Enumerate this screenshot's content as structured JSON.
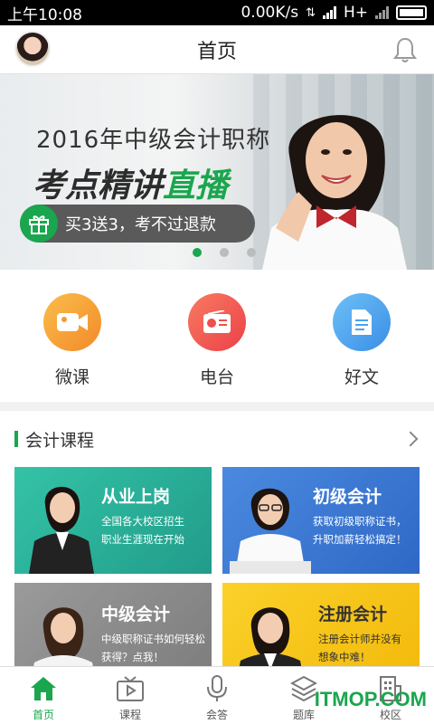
{
  "status_bar": {
    "time": "上午10:08",
    "speed": "0.00K/s",
    "network": "H+"
  },
  "header": {
    "title": "首页",
    "avatar_icon": "avatar-photo",
    "bell_icon": "bell-icon"
  },
  "banner": {
    "line1": "2016年中级会计职称",
    "line2_dark": "考点精讲",
    "line2_green": "直播",
    "promo": "买3送3，考不过退款",
    "slide_count": 3,
    "active_slide": 1
  },
  "quick_menu": [
    {
      "label": "微课",
      "icon": "video-icon",
      "color": "#f7a135"
    },
    {
      "label": "电台",
      "icon": "radio-icon",
      "color": "#f05a4f"
    },
    {
      "label": "好文",
      "icon": "document-icon",
      "color": "#4aa3ee"
    }
  ],
  "course_section": {
    "title": "会计课程",
    "cards": [
      {
        "title": "从业上岗",
        "subtitle_line1": "全国各大校区招生",
        "subtitle_line2": "职业生涯现在开始",
        "color": "#2bb59b"
      },
      {
        "title": "初级会计",
        "subtitle_line1": "获取初级职称证书，",
        "subtitle_line2": "升职加薪轻松搞定！",
        "color": "#3f7bd4"
      },
      {
        "title": "中级会计",
        "subtitle_line1": "中级职称证书如何轻松",
        "subtitle_line2": "获得？点我！",
        "color": "#8d8d8d"
      },
      {
        "title": "注册会计",
        "subtitle_line1": "注册会计师并没有",
        "subtitle_line2": "想象中难！",
        "color": "#f6c51a"
      }
    ]
  },
  "tab_bar": [
    {
      "label": "首页",
      "icon": "home-icon",
      "active": true
    },
    {
      "label": "课程",
      "icon": "tv-icon",
      "active": false
    },
    {
      "label": "会答",
      "icon": "microphone-icon",
      "active": false
    },
    {
      "label": "题库",
      "icon": "layers-icon",
      "active": false
    },
    {
      "label": "校区",
      "icon": "building-icon",
      "active": false
    }
  ],
  "watermark": "ITMOP.COM",
  "colors": {
    "brand_green": "#1aa64e"
  }
}
